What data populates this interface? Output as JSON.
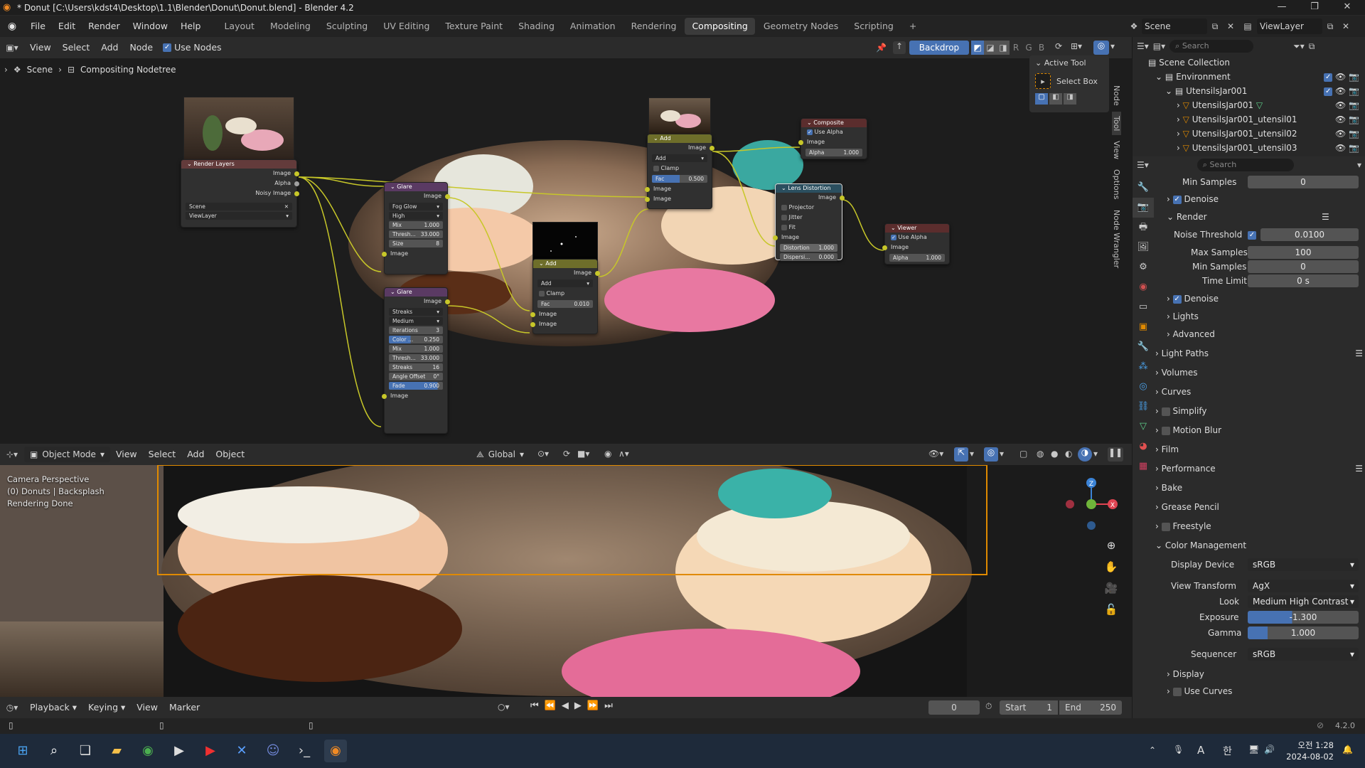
{
  "window": {
    "title": "* Donut [C:\\Users\\kdst4\\Desktop\\1.1\\Blender\\Donut\\Donut.blend] - Blender 4.2"
  },
  "menu": [
    "File",
    "Edit",
    "Render",
    "Window",
    "Help"
  ],
  "workspaces": [
    "Layout",
    "Modeling",
    "Sculpting",
    "UV Editing",
    "Texture Paint",
    "Shading",
    "Animation",
    "Rendering",
    "Compositing",
    "Geometry Nodes",
    "Scripting"
  ],
  "active_workspace": "Compositing",
  "scene": {
    "name": "Scene",
    "view_layer": "ViewLayer"
  },
  "node_editor": {
    "header": {
      "view": "View",
      "select": "Select",
      "add": "Add",
      "node": "Node",
      "use_nodes": "Use Nodes",
      "backdrop": "Backdrop",
      "channels": [
        "R",
        "G",
        "B"
      ]
    },
    "breadcrumb": {
      "scene": "Scene",
      "tree": "Compositing Nodetree"
    },
    "active_tool": {
      "title": "Active Tool",
      "tool": "Select Box"
    },
    "side_tabs": [
      "Node",
      "Tool",
      "View",
      "Options",
      "Node Wrangler"
    ],
    "nodes": {
      "render_layers": {
        "title": "Render Layers",
        "outputs": [
          "Image",
          "Alpha",
          "Noisy Image"
        ],
        "scene": "Scene",
        "layer": "ViewLayer"
      },
      "glare1": {
        "title": "Glare",
        "out": "Image",
        "type": "Fog Glow",
        "quality": "High",
        "mix_label": "Mix",
        "mix": "1.000",
        "thresh_label": "Thresh...",
        "thresh": "33.000",
        "size_label": "Size",
        "size": "8",
        "in": "Image"
      },
      "glare2": {
        "title": "Glare",
        "out": "Image",
        "type": "Streaks",
        "quality": "Medium",
        "iter_label": "Iterations",
        "iter": "3",
        "color_label": "Color ...",
        "color": "0.250",
        "mix_label": "Mix",
        "mix": "1.000",
        "thresh_label": "Thresh...",
        "thresh": "33.000",
        "streaks_label": "Streaks",
        "streaks": "16",
        "angle_label": "Angle Offset",
        "angle": "0°",
        "fade_label": "Fade",
        "fade": "0.900",
        "in": "Image"
      },
      "add1": {
        "title": "Add",
        "out": "Image",
        "blend": "Add",
        "clamp": "Clamp",
        "fac_label": "Fac",
        "fac": "0.010",
        "in1": "Image",
        "in2": "Image"
      },
      "add2": {
        "title": "Add",
        "out": "Image",
        "blend": "Add",
        "clamp": "Clamp",
        "fac_label": "Fac",
        "fac": "0.500",
        "in1": "Image",
        "in2": "Image"
      },
      "composite": {
        "title": "Composite",
        "use_alpha": "Use Alpha",
        "in1": "Image",
        "alpha_label": "Alpha",
        "alpha": "1.000"
      },
      "lens": {
        "title": "Lens Distortion",
        "out": "Image",
        "projector": "Projector",
        "jitter": "Jitter",
        "fit": "Fit",
        "in": "Image",
        "dist_label": "Distortion",
        "dist": "1.000",
        "disp_label": "Dispersi...",
        "disp": "0.000"
      },
      "viewer": {
        "title": "Viewer",
        "use_alpha": "Use Alpha",
        "in1": "Image",
        "alpha_label": "Alpha",
        "alpha": "1.000"
      }
    }
  },
  "viewport": {
    "header": {
      "mode": "Object Mode",
      "view": "View",
      "select": "Select",
      "add": "Add",
      "object": "Object",
      "orientation": "Global"
    },
    "overlay": [
      "Camera Perspective",
      "(0) Donuts | Backsplash",
      "Rendering Done"
    ],
    "gizmo": {
      "z": "Z",
      "x": "X"
    }
  },
  "timeline": {
    "playback": "Playback",
    "keying": "Keying",
    "view": "View",
    "marker": "Marker",
    "frame": "0",
    "start_label": "Start",
    "start": "1",
    "end_label": "End",
    "end": "250"
  },
  "outliner": {
    "search_placeholder": "Search",
    "items": [
      {
        "label": "Scene Collection"
      },
      {
        "label": "Environment"
      },
      {
        "label": "UtensilsJar001"
      },
      {
        "label": "UtensilsJar001"
      },
      {
        "label": "UtensilsJar001_utensil01"
      },
      {
        "label": "UtensilsJar001_utensil02"
      },
      {
        "label": "UtensilsJar001_utensil03"
      }
    ]
  },
  "properties": {
    "search_placeholder": "Search",
    "min_samples_top_label": "Min Samples",
    "min_samples_top": "0",
    "denoise1": "Denoise",
    "render": "Render",
    "noise_threshold_label": "Noise Threshold",
    "noise_threshold": "0.0100",
    "max_samples_label": "Max Samples",
    "max_samples": "100",
    "min_samples_label": "Min Samples",
    "min_samples": "0",
    "time_limit_label": "Time Limit",
    "time_limit": "0 s",
    "denoise2": "Denoise",
    "lights": "Lights",
    "advanced": "Advanced",
    "sections": [
      "Light Paths",
      "Volumes",
      "Curves",
      "Simplify",
      "Motion Blur",
      "Film",
      "Performance",
      "Bake",
      "Grease Pencil",
      "Freestyle",
      "Color Management"
    ],
    "display_device_label": "Display Device",
    "display_device": "sRGB",
    "view_transform_label": "View Transform",
    "view_transform": "AgX",
    "look_label": "Look",
    "look": "Medium High Contrast",
    "exposure_label": "Exposure",
    "exposure": "-1.300",
    "gamma_label": "Gamma",
    "gamma": "1.000",
    "sequencer_label": "Sequencer",
    "sequencer": "sRGB",
    "display": "Display",
    "use_curves": "Use Curves"
  },
  "statusbar": {
    "version": "4.2.0"
  },
  "taskbar": {
    "time": "오전 1:28",
    "date": "2024-08-02",
    "ime1": "A",
    "ime2": "한"
  },
  "colors": {
    "accent": "#4772b3",
    "link": "#c7c729",
    "orange": "#e08a00"
  }
}
